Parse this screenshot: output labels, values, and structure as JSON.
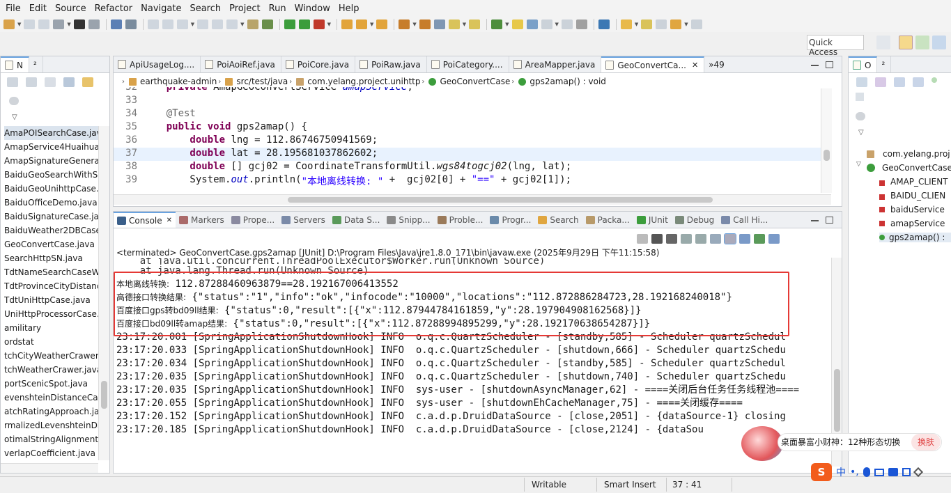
{
  "menu": [
    "File",
    "Edit",
    "Source",
    "Refactor",
    "Navigate",
    "Search",
    "Project",
    "Run",
    "Window",
    "Help"
  ],
  "quick_access": "Quick Access",
  "left_pane": {
    "tabs": [
      "N",
      "²"
    ],
    "files": [
      "AmaPOISearchCase.java",
      "AmapService4Huaihua",
      "AmapSignatureGenera",
      "BaiduGeoSearchWithS",
      "BaiduGeoUnihttpCase.j",
      "BaiduOfficeDemo.java",
      "BaiduSignatureCase.jav",
      "BaiduWeather2DBCase",
      "GeoConvertCase.java",
      "SearchHttpSN.java",
      "TdtNameSearchCaseW",
      "TdtProvinceCityDistanc",
      "TdtUniHttpCase.java",
      "UniHttpProcessorCase.",
      "amilitary",
      "ordstat",
      "tchCityWeatherCrawer.j",
      "tchWeatherCrawer.java",
      "portScenicSpot.java",
      "evenshteinDistanceCase.j",
      "atchRatingApproach.jav",
      "rmalizedLevenshteinDi",
      "otimalStringAlignmentD",
      "verlapCoefficient.java"
    ]
  },
  "editor": {
    "tabs": [
      "ApiUsageLog....",
      "PoiAoiRef.java",
      "PoiCore.java",
      "PoiRaw.java",
      "PoiCategory....",
      "AreaMapper.java",
      "GeoConvertCa...",
      "»49"
    ],
    "breadcrumb": [
      "earthquake-admin",
      "src/test/java",
      "com.yelang.project.unihttp",
      "GeoConvertCase",
      "gps2amap() : void"
    ],
    "lines": [
      {
        "num": "32",
        "tokens": [
          {
            "c": "kw",
            "t": "    private "
          },
          {
            "c": "",
            "t": "AmapGeoConvertService "
          },
          {
            "c": "fld",
            "t": "amapService"
          },
          {
            "c": "",
            "t": ";"
          }
        ]
      },
      {
        "num": "33",
        "tokens": [
          {
            "c": "",
            "t": ""
          }
        ]
      },
      {
        "num": "34",
        "tokens": [
          {
            "c": "ann",
            "t": "    @Test"
          }
        ]
      },
      {
        "num": "35",
        "tokens": [
          {
            "c": "kw",
            "t": "    public void "
          },
          {
            "c": "",
            "t": "gps2amap() {"
          }
        ]
      },
      {
        "num": "36",
        "tokens": [
          {
            "c": "kw",
            "t": "        double "
          },
          {
            "c": "",
            "t": "lng = 112.86746750941569;"
          }
        ]
      },
      {
        "num": "37",
        "tokens": [
          {
            "c": "kw",
            "t": "        double "
          },
          {
            "c": "",
            "t": "lat = 28.19568103786260​2;"
          }
        ]
      },
      {
        "num": "38",
        "tokens": [
          {
            "c": "kw",
            "t": "        double "
          },
          {
            "c": "",
            "t": "[] gcj02 = CoordinateTransformUtil."
          },
          {
            "c": "ital",
            "t": "wgs84togcj02"
          },
          {
            "c": "",
            "t": "(lng, lat);"
          }
        ]
      },
      {
        "num": "39",
        "tokens": [
          {
            "c": "",
            "t": "        System."
          },
          {
            "c": "fld",
            "t": "out"
          },
          {
            "c": "",
            "t": ".println("
          },
          {
            "c": "str",
            "t": "\"本地离线转换: \""
          },
          {
            "c": "",
            "t": " +  gcj02[0] + "
          },
          {
            "c": "str",
            "t": "\"==\""
          },
          {
            "c": "",
            "t": " + gcj02[1]);"
          }
        ]
      }
    ]
  },
  "console": {
    "tabs": [
      "Console",
      "Markers",
      "Prope...",
      "Servers",
      "Data S...",
      "Snipp...",
      "Proble...",
      "Progr...",
      "Search",
      "Packa...",
      "JUnit",
      "Debug",
      "Call Hi..."
    ],
    "header": "<terminated> GeoConvertCase.gps2amap [JUnit] D:\\Program Files\\Java\\jre1.8.0_171\\bin\\javaw.exe (2025年9月29日 下午11:15:58)",
    "partial": "    at java.lang.Thread.run(Unknown Source)",
    "highlighted": [
      {
        "prefix": "本地离线转换:",
        "text": " 112.87288460963879==28.192167006413552"
      },
      {
        "prefix": "高德接口转换结果:",
        "text": " {\"status\":\"1\",\"info\":\"ok\",\"infocode\":\"10000\",\"locations\":\"112.872886284723,28.192168240018\"}"
      },
      {
        "prefix": "百度接口gps转bd09ll结果:",
        "text": " {\"status\":0,\"result\":[{\"x\":112.87944784161859,\"y\":28.197904908162568}]}"
      },
      {
        "prefix": "百度接口bd09ll转amap结果:",
        "text": " {\"status\":0,\"result\":[{\"x\":112.87288994895299,\"y\":28.192170638654287}]}"
      }
    ],
    "logs": [
      "23:17:20.001 [SpringApplicationShutdownHook] INFO  o.q.c.QuartzScheduler - [standby,585] - Scheduler quartzSchedul",
      "23:17:20.033 [SpringApplicationShutdownHook] INFO  o.q.c.QuartzScheduler - [shutdown,666] - Scheduler quartzSchedu",
      "23:17:20.034 [SpringApplicationShutdownHook] INFO  o.q.c.QuartzScheduler - [standby,585] - Scheduler quartzSchedul",
      "23:17:20.035 [SpringApplicationShutdownHook] INFO  o.q.c.QuartzScheduler - [shutdown,740] - Scheduler quartzSchedu",
      "23:17:20.035 [SpringApplicationShutdownHook] INFO  sys-user - [shutdownAsyncManager,62] - ====关闭后台任务任务线程池====",
      "23:17:20.055 [SpringApplicationShutdownHook] INFO  sys-user - [shutdownEhCacheManager,75] - ====关闭缓存====",
      "23:17:20.152 [SpringApplicationShutdownHook] INFO  c.a.d.p.DruidDataSource - [close,2051] - {dataSource-1} closing",
      "23:17:20.185 [SpringApplicationShutdownHook] INFO  c.a.d.p.DruidDataSource - [close,2124] - {dataSou"
    ]
  },
  "outline": {
    "tabs": [
      "O",
      "²"
    ],
    "items": [
      "com.yelang.proj",
      "GeoConvertCase",
      "AMAP_CLIENT",
      "BAIDU_CLIEN",
      "baiduService",
      "amapService",
      "gps2amap() :"
    ]
  },
  "popup": {
    "text": "桌面暴富小财神：12种形态切换",
    "button": "换肤"
  },
  "status": {
    "writable": "Writable",
    "insert": "Smart Insert",
    "position": "37 : 41"
  },
  "colors": {
    "highlight_box": "#e53935",
    "keyword": "#7f0055",
    "string": "#2a00ff"
  }
}
